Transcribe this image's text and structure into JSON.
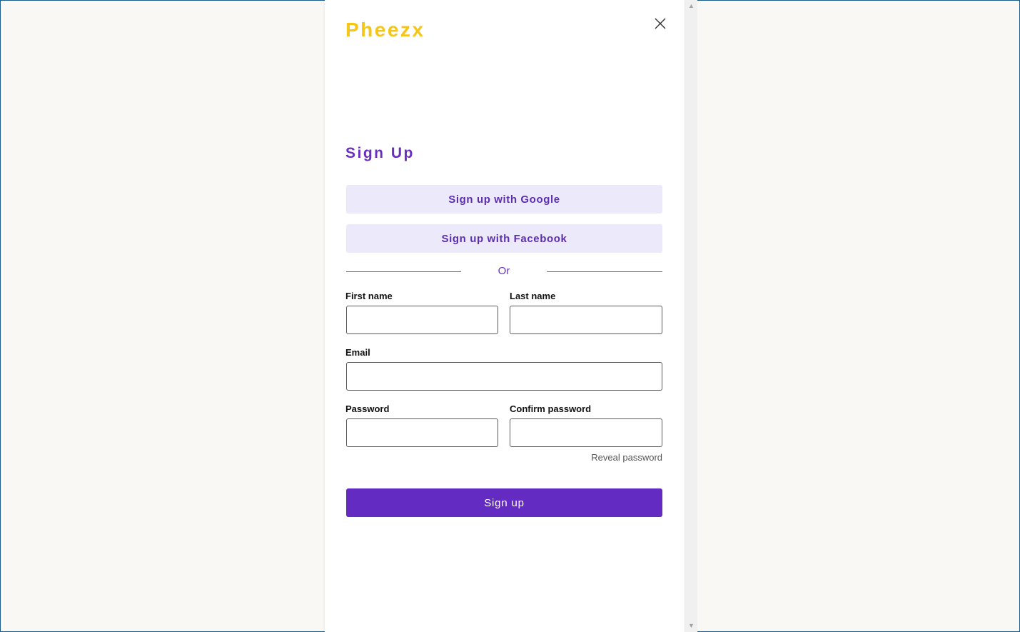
{
  "brand": {
    "name": "Pheezx",
    "color": "#f5c518"
  },
  "close_icon": "close-icon",
  "form": {
    "title": "Sign Up",
    "google_label": "Sign up with Google",
    "facebook_label": "Sign up with Facebook",
    "divider_text": "Or",
    "fields": {
      "first_name": {
        "label": "First name",
        "value": ""
      },
      "last_name": {
        "label": "Last name",
        "value": ""
      },
      "email": {
        "label": "Email",
        "value": ""
      },
      "password": {
        "label": "Password",
        "value": ""
      },
      "confirm_password": {
        "label": "Confirm password",
        "value": ""
      }
    },
    "reveal_label": "Reveal password",
    "submit_label": "Sign up"
  },
  "colors": {
    "accent": "#632bc1",
    "social_bg": "#ece9fb",
    "title": "#6a2fc0",
    "page_bg": "#f9f8f4"
  }
}
